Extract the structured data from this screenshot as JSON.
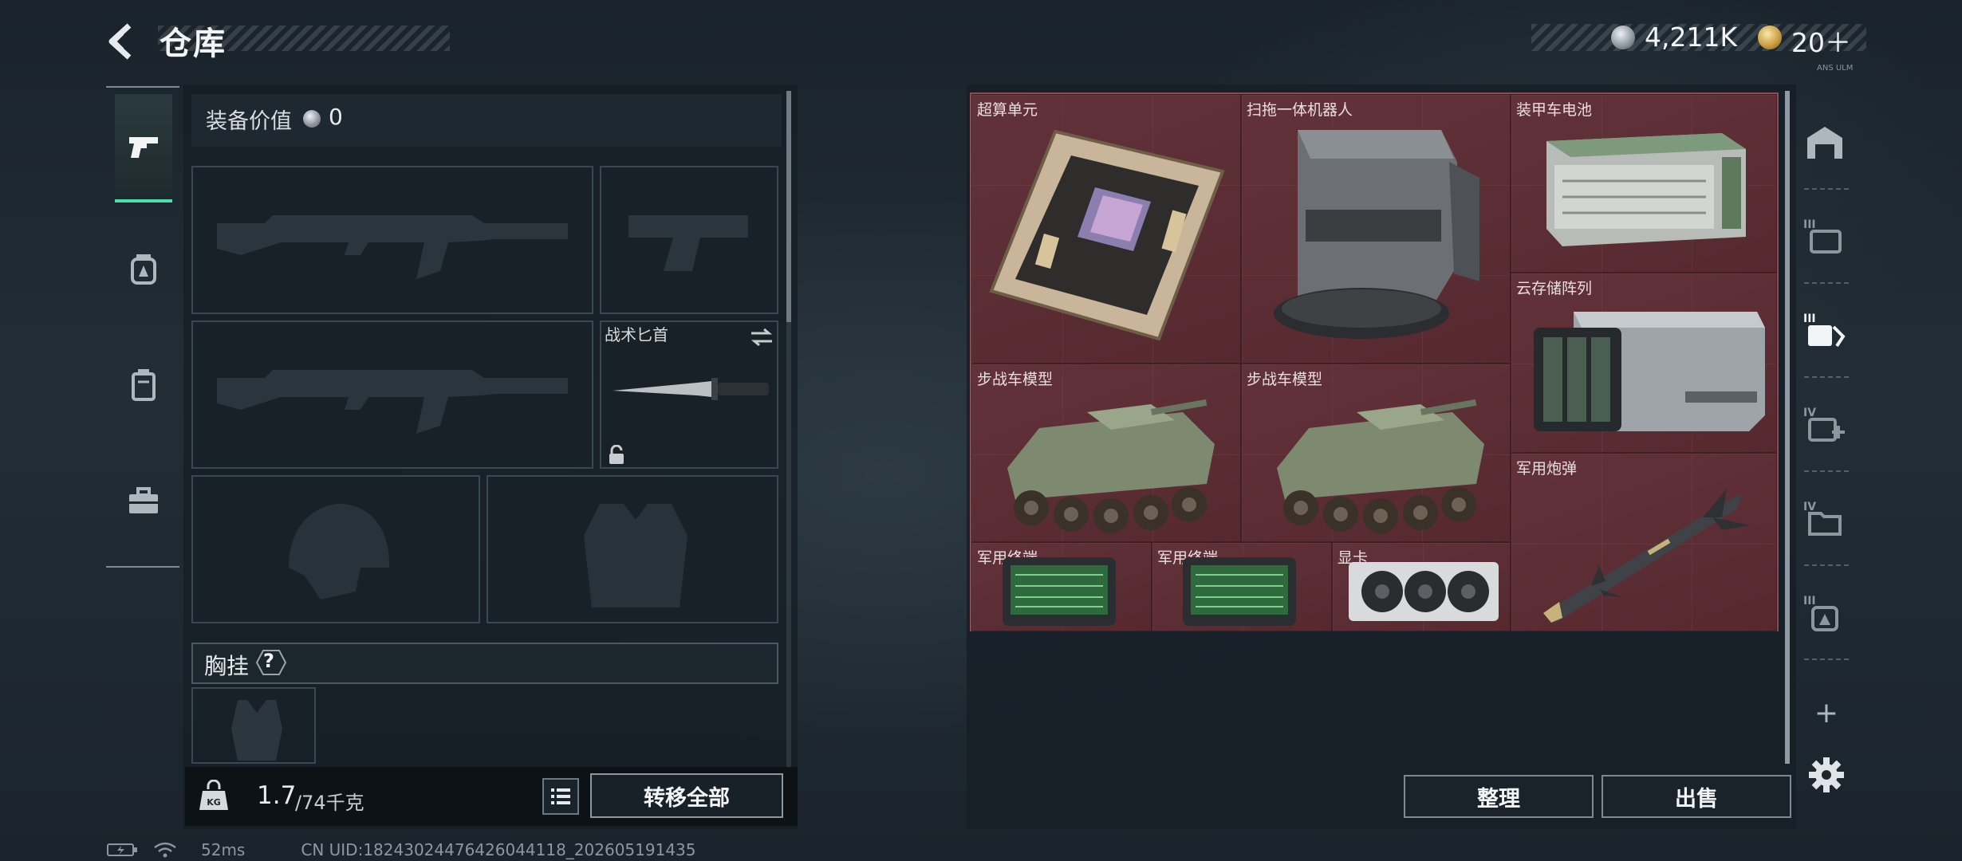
{
  "header": {
    "title": "仓库",
    "back_icon": "back-arrow-icon"
  },
  "currency": {
    "silver_value": "4,211K",
    "gold_value": "20＋",
    "gold_sub": "ANS ULM"
  },
  "categories": [
    {
      "name": "weapons",
      "icon": "pistol-icon",
      "active": true
    },
    {
      "name": "backpack",
      "icon": "backpack-icon",
      "active": false
    },
    {
      "name": "container",
      "icon": "canister-icon",
      "active": false
    },
    {
      "name": "toolbox",
      "icon": "toolbox-icon",
      "active": false
    }
  ],
  "loadout": {
    "equip_value_label": "装备价值",
    "equip_value": "0",
    "knife_label": "战术匕首",
    "chest_label": "胸挂",
    "chest_help": "?"
  },
  "capacity": {
    "current": "1.7",
    "max": "/74千克",
    "transfer_all": "转移全部"
  },
  "storage": {
    "items": [
      {
        "label": "超算单元",
        "icon": "supercomputer-board-icon"
      },
      {
        "label": "扫拖一体机器人",
        "icon": "robot-vacuum-icon"
      },
      {
        "label": "装甲车电池",
        "icon": "vehicle-battery-icon"
      },
      {
        "label": "云存储阵列",
        "icon": "storage-array-icon"
      },
      {
        "label": "步战车模型",
        "icon": "ifv-model-icon"
      },
      {
        "label": "步战车模型",
        "icon": "ifv-model-icon"
      },
      {
        "label": "军用炮弹",
        "icon": "missile-icon"
      },
      {
        "label": "军用终端",
        "icon": "military-terminal-icon"
      },
      {
        "label": "军用终端",
        "icon": "military-terminal-icon"
      },
      {
        "label": "显卡",
        "icon": "graphics-card-icon"
      }
    ],
    "sort_label": "整理",
    "sell_label": "出售"
  },
  "right_rail": [
    {
      "icon": "warehouse-icon"
    },
    {
      "icon": "tier-3-supplies-icon"
    },
    {
      "icon": "tier-3-equipment-icon",
      "active": true
    },
    {
      "icon": "tier-4-medical-icon"
    },
    {
      "icon": "tier-4-files-icon"
    },
    {
      "icon": "tier-3-backpack-icon"
    }
  ],
  "status": {
    "ping": "52ms",
    "uid": "CN UID:18243024476426044118_202605191435"
  },
  "colors": {
    "accent_green": "#4ee0a7",
    "storage_bg": "#5a2c31",
    "panel_bg": "#161e25"
  }
}
